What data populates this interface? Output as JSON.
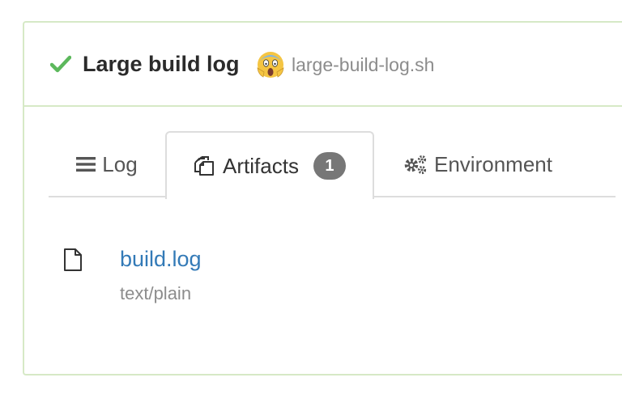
{
  "build": {
    "status": "passed",
    "status_icon": "check-icon",
    "title": "Large build log",
    "emoji": "scream-emoji-icon",
    "script": "large-build-log.sh"
  },
  "tabs": [
    {
      "label": "Log",
      "icon": "list-icon",
      "active": false
    },
    {
      "label": "Artifacts",
      "icon": "copy-files-icon",
      "active": true,
      "badge": "1"
    },
    {
      "label": "Environment",
      "icon": "gears-icon",
      "active": false
    }
  ],
  "artifacts": [
    {
      "name": "build.log",
      "type": "text/plain",
      "icon": "file-icon"
    }
  ],
  "colors": {
    "success": "#5cb85c",
    "panel_border": "#d6e9c6",
    "link": "#337ab7",
    "muted": "#8c8c8c",
    "badge": "#777777"
  }
}
